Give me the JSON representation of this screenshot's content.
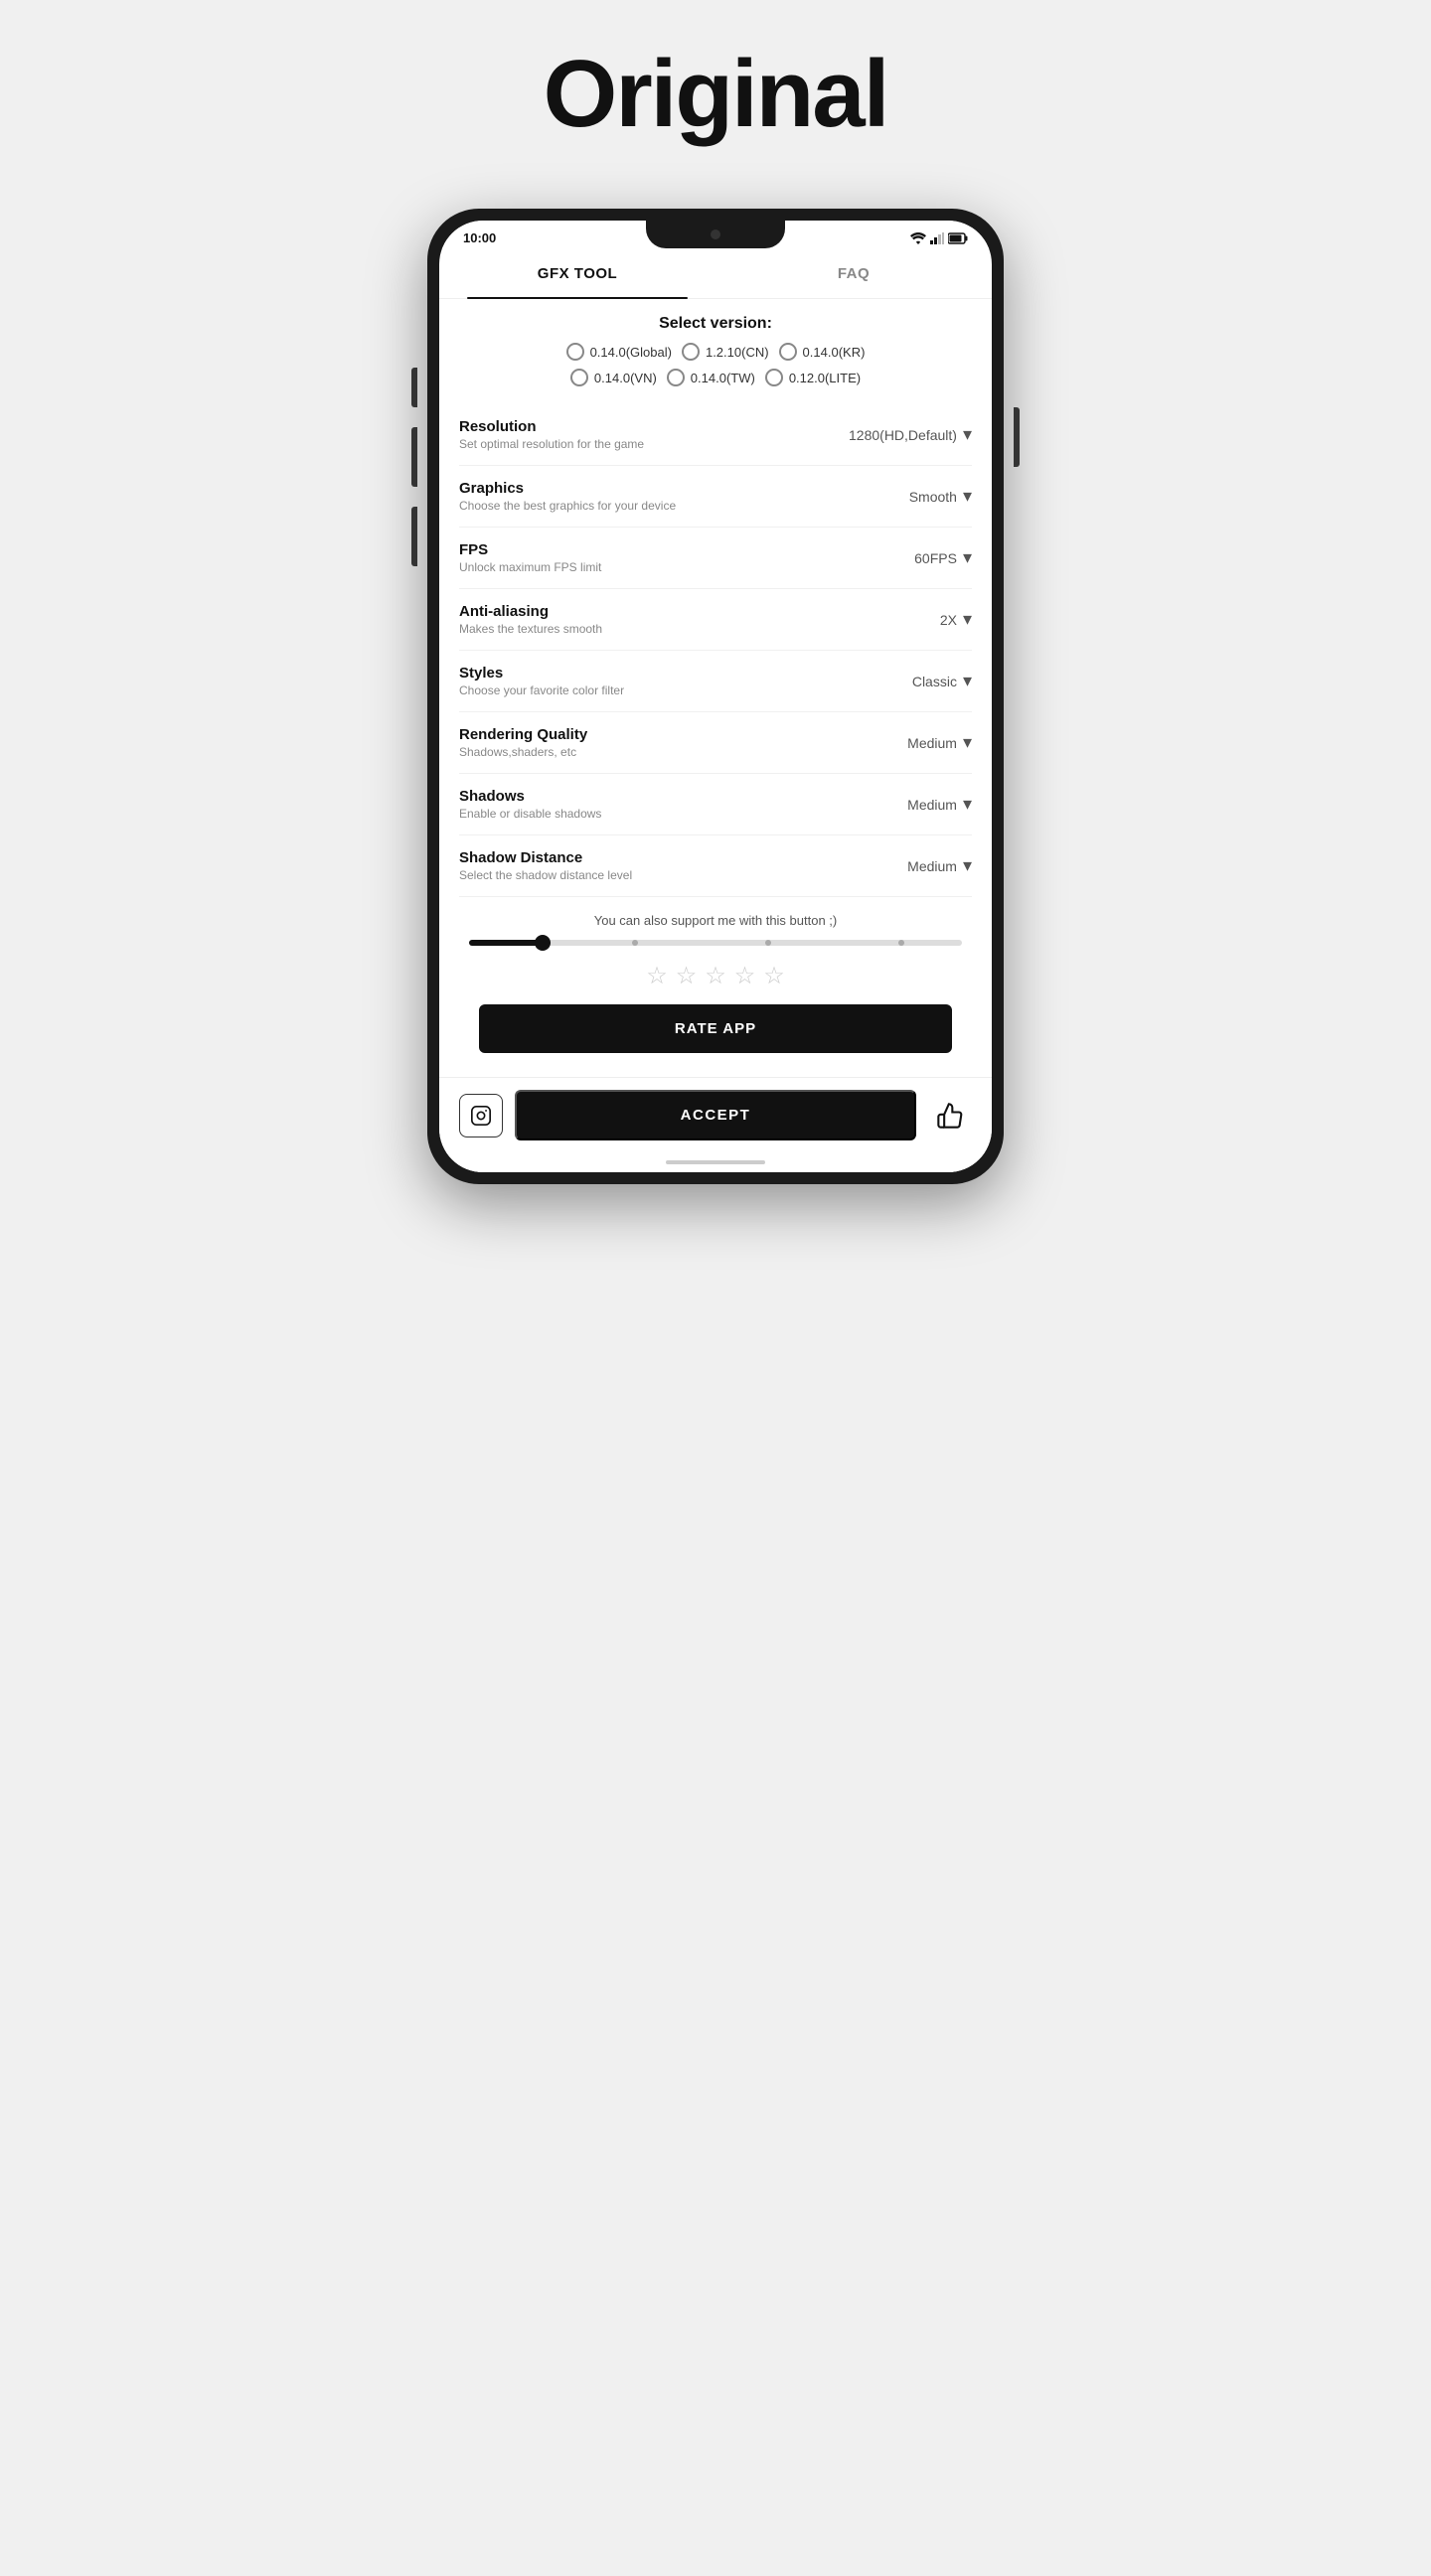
{
  "page": {
    "title": "Original"
  },
  "status_bar": {
    "time": "10:00"
  },
  "tabs": [
    {
      "id": "gfx-tool",
      "label": "GFX TOOL",
      "active": true
    },
    {
      "id": "faq",
      "label": "FAQ",
      "active": false
    }
  ],
  "version_section": {
    "title": "Select version:",
    "options": [
      {
        "id": "global",
        "label": "0.14.0(Global)"
      },
      {
        "id": "cn",
        "label": "1.2.10(CN)"
      },
      {
        "id": "kr",
        "label": "0.14.0(KR)"
      },
      {
        "id": "vn",
        "label": "0.14.0(VN)"
      },
      {
        "id": "tw",
        "label": "0.14.0(TW)"
      },
      {
        "id": "lite",
        "label": "0.12.0(LITE)"
      }
    ]
  },
  "settings": [
    {
      "id": "resolution",
      "label": "Resolution",
      "desc": "Set optimal resolution for the game",
      "value": "1280(HD,Default)"
    },
    {
      "id": "graphics",
      "label": "Graphics",
      "desc": "Choose the best graphics for your device",
      "value": "Smooth"
    },
    {
      "id": "fps",
      "label": "FPS",
      "desc": "Unlock maximum FPS limit",
      "value": "60FPS"
    },
    {
      "id": "anti-aliasing",
      "label": "Anti-aliasing",
      "desc": "Makes the textures smooth",
      "value": "2X"
    },
    {
      "id": "styles",
      "label": "Styles",
      "desc": "Choose your favorite color filter",
      "value": "Classic"
    },
    {
      "id": "rendering-quality",
      "label": "Rendering Quality",
      "desc": "Shadows,shaders, etc",
      "value": "Medium"
    },
    {
      "id": "shadows",
      "label": "Shadows",
      "desc": "Enable or disable shadows",
      "value": "Medium"
    },
    {
      "id": "shadow-distance",
      "label": "Shadow Distance",
      "desc": "Select the shadow distance level",
      "value": "Medium"
    }
  ],
  "support": {
    "text": "You can also support me with this button ;)",
    "slider_value": 15
  },
  "stars": {
    "count": 5,
    "filled": 0
  },
  "rate_btn": "RATE APP",
  "accept_btn": "ACCEPT"
}
